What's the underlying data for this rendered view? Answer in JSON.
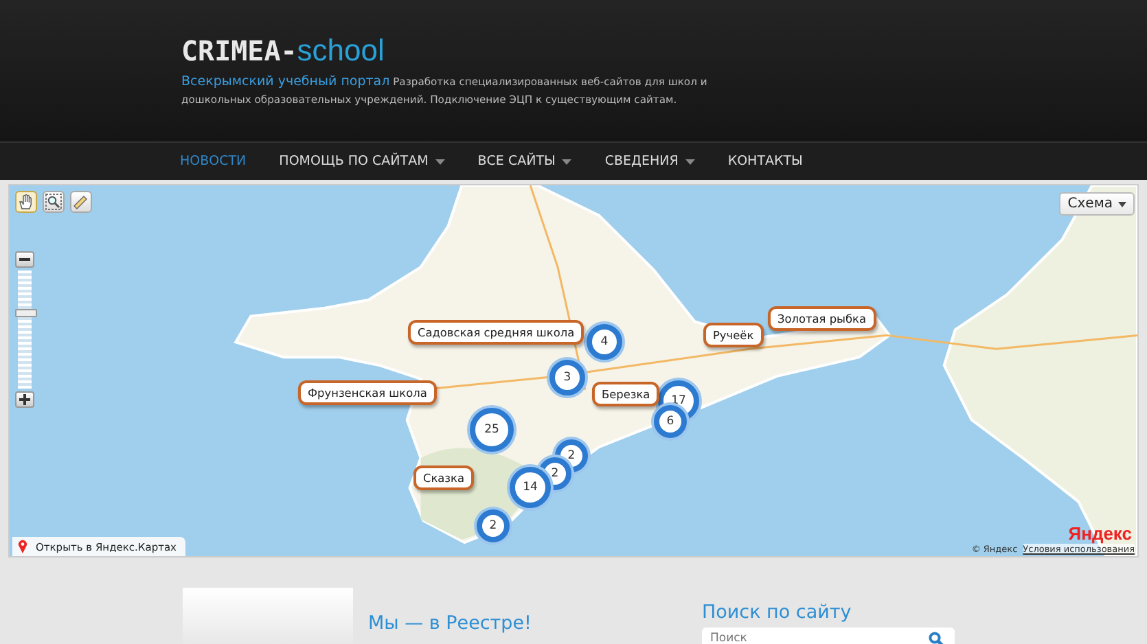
{
  "header": {
    "logo_main": "CRIMEA-",
    "logo_accent": "school",
    "tagline_title": "Всекрымский учебный портал",
    "tagline_text": "Разработка специализированных веб-сайтов для школ и дошкольных образовательных учреждений. Подключение ЭЦП к существующим сайтам."
  },
  "nav": {
    "items": [
      {
        "label": "НОВОСТИ",
        "selected": true,
        "dropdown": false
      },
      {
        "label": "ПОМОЩЬ ПО САЙТАМ",
        "selected": false,
        "dropdown": true
      },
      {
        "label": "ВСЕ САЙТЫ",
        "selected": false,
        "dropdown": true
      },
      {
        "label": "СВЕДЕНИЯ",
        "selected": false,
        "dropdown": true
      },
      {
        "label": "КОНТАКТЫ",
        "selected": false,
        "dropdown": false
      }
    ]
  },
  "map": {
    "tools": [
      {
        "kind": "hand",
        "selected": true
      },
      {
        "kind": "magnifier",
        "selected": false
      },
      {
        "kind": "ruler",
        "selected": false
      }
    ],
    "zoom": {
      "level": 0.6
    },
    "layer_button": "Схема",
    "clusters": [
      {
        "count": "4"
      },
      {
        "count": "3"
      },
      {
        "count": "25"
      },
      {
        "count": "2"
      },
      {
        "count": "2"
      },
      {
        "count": "14"
      },
      {
        "count": "2"
      },
      {
        "count": "17"
      },
      {
        "count": "6"
      }
    ],
    "balloons": [
      {
        "label": "Садовская средняя школа"
      },
      {
        "label": "Фрунзенская школа"
      },
      {
        "label": "Сказка"
      },
      {
        "label": "Березка"
      },
      {
        "label": "Ручеёк"
      },
      {
        "label": "Золотая рыбка"
      }
    ],
    "open_link": "Открыть в Яндекс.Картах",
    "logo": "Яндекс",
    "copyright": "© Яндекс",
    "terms": "Условия использования"
  },
  "registry": {
    "title": "Мы — в Реестре!"
  },
  "search": {
    "title": "Поиск по сайту",
    "placeholder": "Поиск"
  }
}
